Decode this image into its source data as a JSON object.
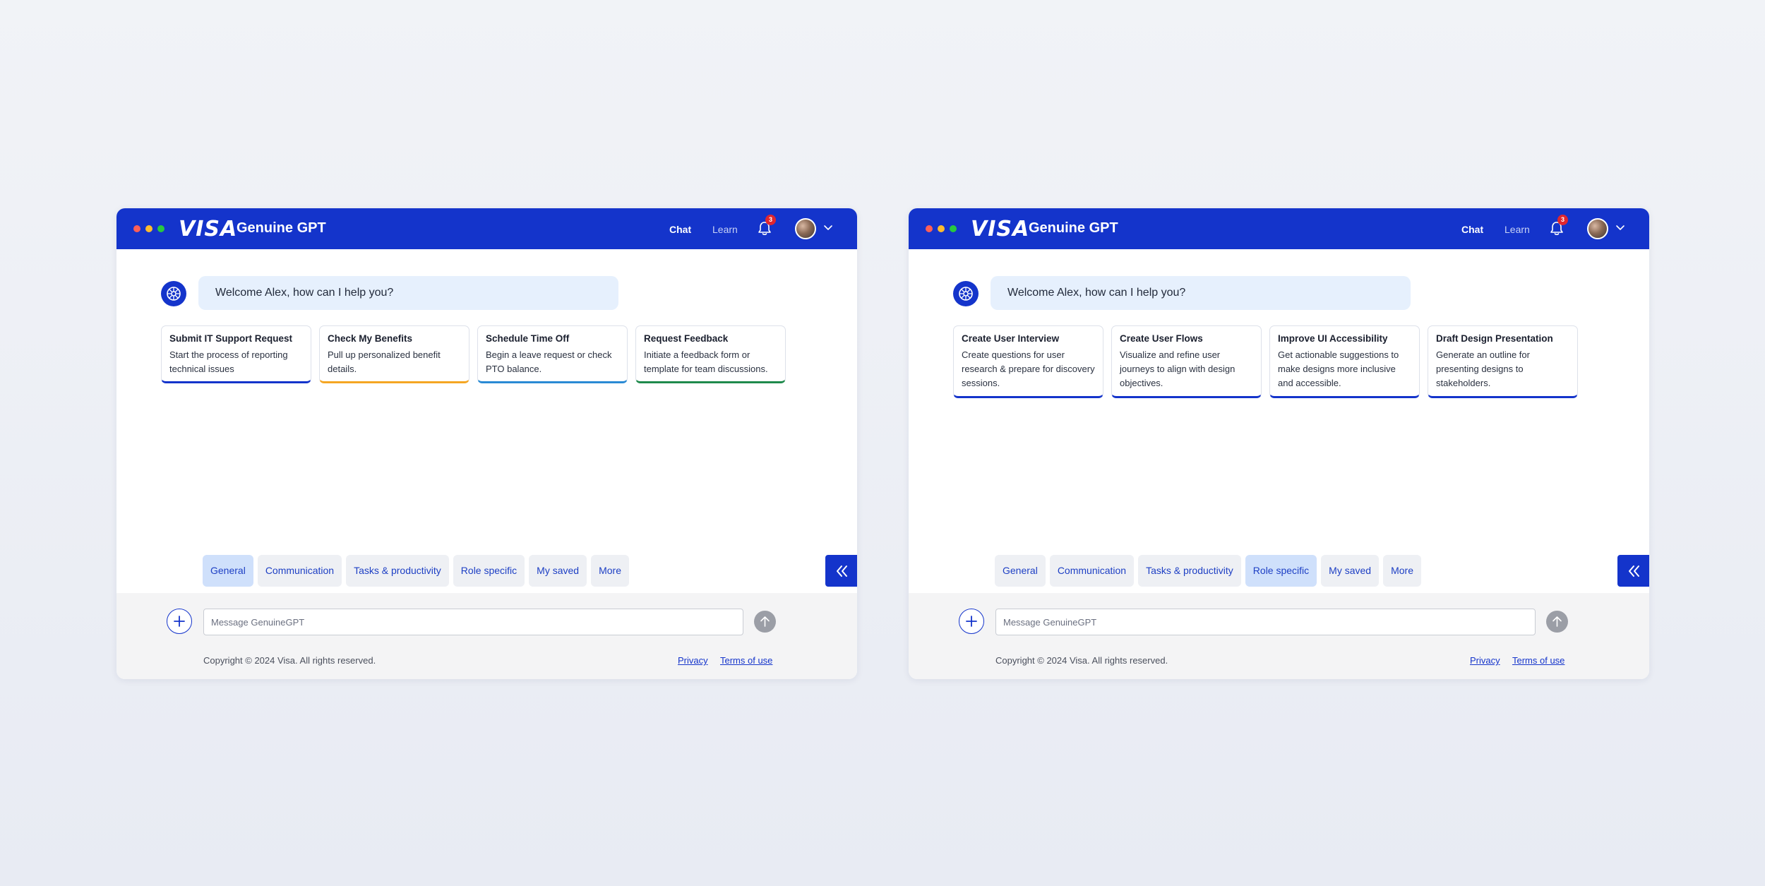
{
  "windows": [
    {
      "header": {
        "logo_text": "VISA",
        "app_title": "Genuine GPT",
        "nav_chat": "Chat",
        "nav_learn": "Learn",
        "notification_count": "3"
      },
      "welcome_message": "Welcome Alex, how can I help you?",
      "cards": [
        {
          "title": "Submit IT Support Request",
          "description": "Start the process of reporting technical issues",
          "accent": "#1434cb"
        },
        {
          "title": "Check My Benefits",
          "description": "Pull up personalized benefit details.",
          "accent": "#f5a623"
        },
        {
          "title": "Schedule Time Off",
          "description": "Begin a leave request or check PTO balance.",
          "accent": "#2a8ad4"
        },
        {
          "title": "Request Feedback",
          "description": "Initiate a feedback form or template for team discussions.",
          "accent": "#1f8a4c"
        }
      ],
      "chips": [
        "General",
        "Communication",
        "Tasks & productivity",
        "Role specific",
        "My saved",
        "More"
      ],
      "active_chip": "General",
      "composer": {
        "placeholder": "Message GenuineGPT"
      },
      "footer": {
        "copyright": "Copyright © 2024 Visa. All rights reserved.",
        "privacy": "Privacy",
        "terms": "Terms of use"
      }
    },
    {
      "header": {
        "logo_text": "VISA",
        "app_title": "Genuine GPT",
        "nav_chat": "Chat",
        "nav_learn": "Learn",
        "notification_count": "3"
      },
      "welcome_message": "Welcome Alex, how can I help you?",
      "cards": [
        {
          "title": "Create User Interview",
          "description": "Create questions for user research & prepare for discovery sessions.",
          "accent": "#1434cb"
        },
        {
          "title": "Create User Flows",
          "description": "Visualize and refine user journeys to align with design objectives.",
          "accent": "#1434cb"
        },
        {
          "title": "Improve UI Accessibility",
          "description": "Get actionable suggestions to make designs more inclusive and accessible.",
          "accent": "#1434cb"
        },
        {
          "title": "Draft Design Presentation",
          "description": "Generate an outline for presenting designs to stakeholders.",
          "accent": "#1434cb"
        }
      ],
      "chips": [
        "General",
        "Communication",
        "Tasks & productivity",
        "Role specific",
        "My saved",
        "More"
      ],
      "active_chip": "Role specific",
      "composer": {
        "placeholder": "Message GenuineGPT"
      },
      "footer": {
        "copyright": "Copyright © 2024 Visa. All rights reserved.",
        "privacy": "Privacy",
        "terms": "Terms of use"
      }
    }
  ],
  "colors": {
    "brand_blue": "#1434cb",
    "window_dot_red": "#ff5f57",
    "window_dot_yellow": "#febc2e",
    "window_dot_green": "#28c840",
    "badge_red": "#e0262f",
    "chip_active": "#cfe0fb",
    "welcome_bubble": "#e6f0fd"
  },
  "icons": {
    "bot": "brain-icon",
    "bell": "bell-icon",
    "chevron": "chevron-down-icon",
    "collapse": "double-chevron-left-icon",
    "plus": "plus-icon",
    "send": "arrow-up-icon"
  }
}
